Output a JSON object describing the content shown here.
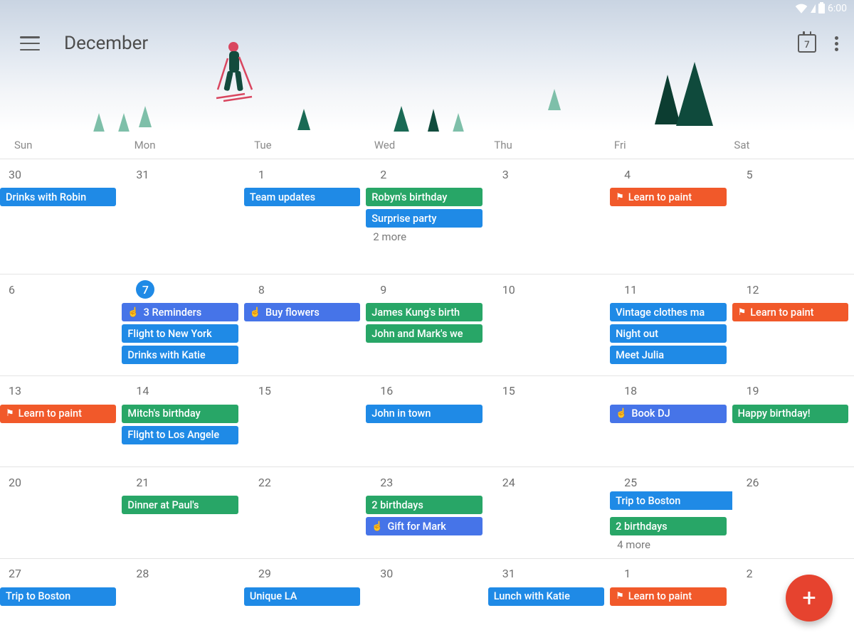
{
  "status": {
    "time": "6:00"
  },
  "header": {
    "month": "December",
    "today_badge": "7"
  },
  "day_headers": [
    "Sun",
    "Mon",
    "Tue",
    "Wed",
    "Thu",
    "Fri",
    "Sat"
  ],
  "colors": {
    "blue": "#1f8ae6",
    "green": "#28a667",
    "orange": "#f1592a",
    "indigo": "#4674e8"
  },
  "weeks": [
    [
      {
        "n": "30",
        "events": [
          {
            "t": "Drinks with Robin",
            "c": "blue"
          }
        ]
      },
      {
        "n": "31",
        "events": []
      },
      {
        "n": "1",
        "events": [
          {
            "t": "Team updates",
            "c": "blue"
          }
        ]
      },
      {
        "n": "2",
        "events": [
          {
            "t": "Robyn's birthday",
            "c": "green"
          },
          {
            "t": "Surprise party",
            "c": "blue"
          }
        ],
        "more": "2 more"
      },
      {
        "n": "3",
        "events": []
      },
      {
        "n": "4",
        "events": [
          {
            "t": "Learn to paint",
            "c": "orange",
            "icon": "flag"
          }
        ]
      },
      {
        "n": "5",
        "events": []
      }
    ],
    [
      {
        "n": "6",
        "events": []
      },
      {
        "n": "7",
        "today": true,
        "events": [
          {
            "t": "3 Reminders",
            "c": "indigo",
            "icon": "touch"
          },
          {
            "t": "Flight to New York",
            "c": "blue"
          },
          {
            "t": "Drinks with Katie",
            "c": "blue"
          }
        ]
      },
      {
        "n": "8",
        "events": [
          {
            "t": "Buy flowers",
            "c": "indigo",
            "icon": "touch"
          }
        ]
      },
      {
        "n": "9",
        "events": [
          {
            "t": "James Kung's birth",
            "c": "green"
          },
          {
            "t": "John and Mark's we",
            "c": "green"
          }
        ]
      },
      {
        "n": "10",
        "events": []
      },
      {
        "n": "11",
        "events": [
          {
            "t": "Vintage clothes ma",
            "c": "blue"
          },
          {
            "t": "Night out",
            "c": "blue"
          },
          {
            "t": "Meet Julia",
            "c": "blue"
          }
        ]
      },
      {
        "n": "12",
        "events": [
          {
            "t": "Learn to paint",
            "c": "orange",
            "icon": "flag"
          }
        ]
      }
    ],
    [
      {
        "n": "13",
        "events": [
          {
            "t": "Learn to paint",
            "c": "orange",
            "icon": "flag"
          }
        ]
      },
      {
        "n": "14",
        "events": [
          {
            "t": "Mitch's birthday",
            "c": "green"
          },
          {
            "t": "Flight to Los Angele",
            "c": "blue"
          }
        ]
      },
      {
        "n": "15",
        "events": []
      },
      {
        "n": "16",
        "events": [
          {
            "t": "John in town",
            "c": "blue"
          }
        ]
      },
      {
        "n": "15",
        "events": []
      },
      {
        "n": "18",
        "events": [
          {
            "t": "Book DJ",
            "c": "indigo",
            "icon": "touch"
          }
        ]
      },
      {
        "n": "19",
        "events": [
          {
            "t": "Happy birthday!",
            "c": "green"
          }
        ]
      }
    ],
    [
      {
        "n": "20",
        "events": []
      },
      {
        "n": "21",
        "events": [
          {
            "t": "Dinner at Paul's",
            "c": "green"
          }
        ]
      },
      {
        "n": "22",
        "events": []
      },
      {
        "n": "23",
        "events": [
          {
            "t": "2 birthdays",
            "c": "green"
          },
          {
            "t": "Gift for Mark",
            "c": "indigo",
            "icon": "touch"
          }
        ]
      },
      {
        "n": "24",
        "events": []
      },
      {
        "n": "25",
        "events": [],
        "span": {
          "t": "Trip to Boston",
          "c": "blue",
          "cols": 2
        },
        "after_span": [
          {
            "t": "2 birthdays",
            "c": "green"
          }
        ],
        "more": "4 more"
      },
      {
        "n": "26",
        "events": []
      }
    ],
    [
      {
        "n": "27",
        "events": [
          {
            "t": "Trip to Boston",
            "c": "blue"
          }
        ]
      },
      {
        "n": "28",
        "events": []
      },
      {
        "n": "29",
        "events": [
          {
            "t": "Unique LA",
            "c": "blue"
          }
        ]
      },
      {
        "n": "30",
        "events": []
      },
      {
        "n": "31",
        "events": [
          {
            "t": "Lunch with Katie",
            "c": "blue"
          }
        ]
      },
      {
        "n": "1",
        "events": [
          {
            "t": "Learn to paint",
            "c": "orange",
            "icon": "flag"
          }
        ]
      },
      {
        "n": "2",
        "events": []
      }
    ]
  ]
}
